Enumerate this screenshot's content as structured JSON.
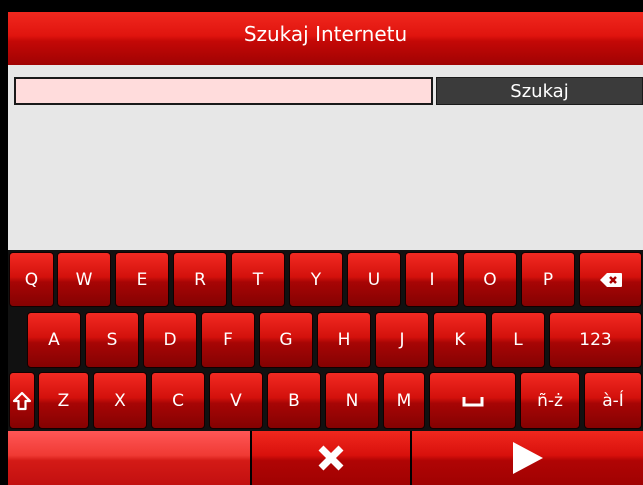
{
  "header": {
    "title": "Szukaj Internetu"
  },
  "search": {
    "value": "",
    "button_label": "Szukaj"
  },
  "keyboard": {
    "row1": [
      "Q",
      "W",
      "E",
      "R",
      "T",
      "Y",
      "U",
      "I",
      "O",
      "P"
    ],
    "row2": [
      "A",
      "S",
      "D",
      "F",
      "G",
      "H",
      "J",
      "K",
      "L"
    ],
    "row3": [
      "Z",
      "X",
      "C",
      "V",
      "B",
      "N",
      "M"
    ],
    "backspace_icon": "backspace-icon",
    "numbers_label": "123",
    "shift_icon": "shift-icon",
    "space_icon": "space-icon",
    "accent1_label": "ñ-ż",
    "accent2_label": "à-Í"
  },
  "bottombar": {
    "cancel_icon": "close-icon",
    "go_icon": "play-icon"
  }
}
